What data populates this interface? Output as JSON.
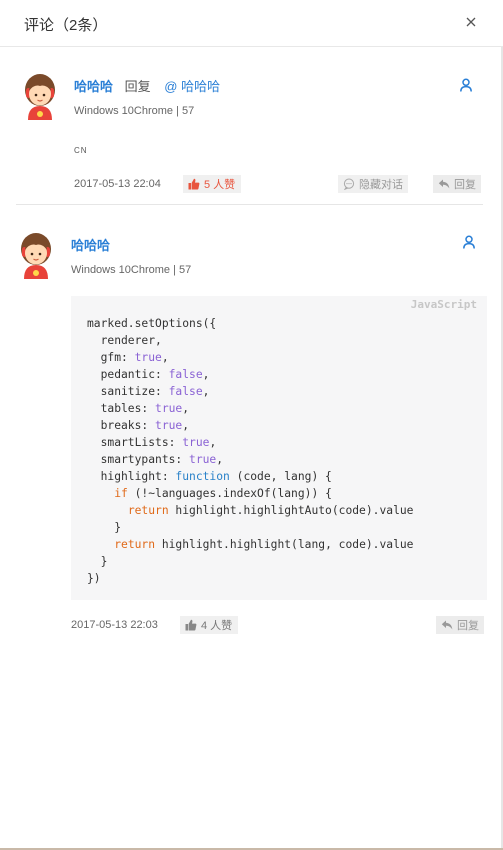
{
  "header": {
    "title": "评论（2条）",
    "close_icon": "close-icon"
  },
  "comments": [
    {
      "username": "哈哈哈",
      "reply_word": "回复",
      "reply_target": "@ 哈哈哈",
      "device": "Windows 10Chrome | 57",
      "content": "CN",
      "time": "2017-05-13 22:04",
      "like_label": "5 人赞",
      "hide_label": "隐藏对话",
      "reply_label": "回复"
    },
    {
      "username": "哈哈哈",
      "device": "Windows 10Chrome | 57",
      "code": {
        "language": "JavaScript",
        "lines": [
          [
            {
              "t": "marked.setOptions({",
              "c": ""
            }
          ],
          [
            {
              "t": "  renderer,",
              "c": ""
            }
          ],
          [
            {
              "t": "  gfm: ",
              "c": ""
            },
            {
              "t": "true",
              "c": "kw-val"
            },
            {
              "t": ",",
              "c": ""
            }
          ],
          [
            {
              "t": "  pedantic: ",
              "c": ""
            },
            {
              "t": "false",
              "c": "kw-val"
            },
            {
              "t": ",",
              "c": ""
            }
          ],
          [
            {
              "t": "  sanitize: ",
              "c": ""
            },
            {
              "t": "false",
              "c": "kw-val"
            },
            {
              "t": ",",
              "c": ""
            }
          ],
          [
            {
              "t": "  tables: ",
              "c": ""
            },
            {
              "t": "true",
              "c": "kw-val"
            },
            {
              "t": ",",
              "c": ""
            }
          ],
          [
            {
              "t": "  breaks: ",
              "c": ""
            },
            {
              "t": "true",
              "c": "kw-val"
            },
            {
              "t": ",",
              "c": ""
            }
          ],
          [
            {
              "t": "  smartLists: ",
              "c": ""
            },
            {
              "t": "true",
              "c": "kw-val"
            },
            {
              "t": ",",
              "c": ""
            }
          ],
          [
            {
              "t": "  smartypants: ",
              "c": ""
            },
            {
              "t": "true",
              "c": "kw-val"
            },
            {
              "t": ",",
              "c": ""
            }
          ],
          [
            {
              "t": "  highlight: ",
              "c": ""
            },
            {
              "t": "function",
              "c": "kw-fn"
            },
            {
              "t": " (code, lang) {",
              "c": ""
            }
          ],
          [
            {
              "t": "    ",
              "c": ""
            },
            {
              "t": "if",
              "c": "kw-ret"
            },
            {
              "t": " (!~languages.indexOf(lang)) {",
              "c": ""
            }
          ],
          [
            {
              "t": "      ",
              "c": ""
            },
            {
              "t": "return",
              "c": "kw-ret"
            },
            {
              "t": " highlight.highlightAuto(code).value",
              "c": ""
            }
          ],
          [
            {
              "t": "    }",
              "c": ""
            }
          ],
          [
            {
              "t": "    ",
              "c": ""
            },
            {
              "t": "return",
              "c": "kw-ret"
            },
            {
              "t": " highlight.highlight(lang, code).value",
              "c": ""
            }
          ],
          [
            {
              "t": "  }",
              "c": ""
            }
          ],
          [
            {
              "t": "})",
              "c": ""
            }
          ]
        ]
      },
      "time": "2017-05-13 22:03",
      "like_label": "4 人赞",
      "reply_label": "回复"
    }
  ],
  "colors": {
    "link_blue": "#2a7fd6",
    "liked_red": "#e8553e",
    "muted_gray": "#999999"
  }
}
